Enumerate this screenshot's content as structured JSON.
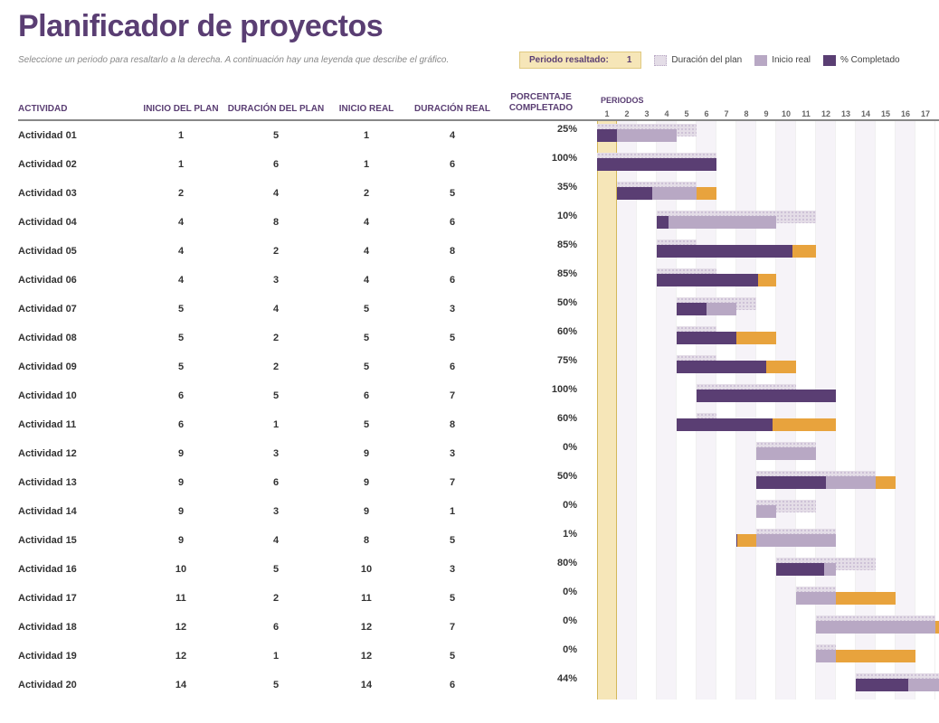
{
  "title": "Planificador de proyectos",
  "hint": "Seleccione un periodo para resaltarlo a la derecha. A continuación hay una leyenda que describe el gráfico.",
  "highlight": {
    "label": "Periodo resaltado:",
    "value": "1"
  },
  "legend": {
    "plan": "Duración del plan",
    "real": "Inicio real",
    "comp": "% Completado"
  },
  "columns": {
    "activity": "ACTIVIDAD",
    "plan_start": "INICIO DEL PLAN",
    "plan_dur": "DURACIÓN DEL PLAN",
    "actual_start": "INICIO REAL",
    "actual_dur": "DURACIÓN REAL",
    "pct": "PORCENTAJE COMPLETADO",
    "periods": "PERIODOS"
  },
  "periods": [
    "1",
    "2",
    "3",
    "4",
    "5",
    "6",
    "7",
    "8",
    "9",
    "10",
    "11",
    "12",
    "13",
    "14",
    "15",
    "16",
    "17"
  ],
  "highlighted_period": 1,
  "rows": [
    {
      "activity": "Actividad 01",
      "plan_start": 1,
      "plan_dur": 5,
      "actual_start": 1,
      "actual_dur": 4,
      "pct": "25%",
      "pct_num": 25
    },
    {
      "activity": "Actividad 02",
      "plan_start": 1,
      "plan_dur": 6,
      "actual_start": 1,
      "actual_dur": 6,
      "pct": "100%",
      "pct_num": 100
    },
    {
      "activity": "Actividad 03",
      "plan_start": 2,
      "plan_dur": 4,
      "actual_start": 2,
      "actual_dur": 5,
      "pct": "35%",
      "pct_num": 35
    },
    {
      "activity": "Actividad 04",
      "plan_start": 4,
      "plan_dur": 8,
      "actual_start": 4,
      "actual_dur": 6,
      "pct": "10%",
      "pct_num": 10
    },
    {
      "activity": "Actividad 05",
      "plan_start": 4,
      "plan_dur": 2,
      "actual_start": 4,
      "actual_dur": 8,
      "pct": "85%",
      "pct_num": 85
    },
    {
      "activity": "Actividad 06",
      "plan_start": 4,
      "plan_dur": 3,
      "actual_start": 4,
      "actual_dur": 6,
      "pct": "85%",
      "pct_num": 85
    },
    {
      "activity": "Actividad 07",
      "plan_start": 5,
      "plan_dur": 4,
      "actual_start": 5,
      "actual_dur": 3,
      "pct": "50%",
      "pct_num": 50
    },
    {
      "activity": "Actividad 08",
      "plan_start": 5,
      "plan_dur": 2,
      "actual_start": 5,
      "actual_dur": 5,
      "pct": "60%",
      "pct_num": 60
    },
    {
      "activity": "Actividad 09",
      "plan_start": 5,
      "plan_dur": 2,
      "actual_start": 5,
      "actual_dur": 6,
      "pct": "75%",
      "pct_num": 75
    },
    {
      "activity": "Actividad 10",
      "plan_start": 6,
      "plan_dur": 5,
      "actual_start": 6,
      "actual_dur": 7,
      "pct": "100%",
      "pct_num": 100
    },
    {
      "activity": "Actividad 11",
      "plan_start": 6,
      "plan_dur": 1,
      "actual_start": 5,
      "actual_dur": 8,
      "pct": "60%",
      "pct_num": 60
    },
    {
      "activity": "Actividad 12",
      "plan_start": 9,
      "plan_dur": 3,
      "actual_start": 9,
      "actual_dur": 3,
      "pct": "0%",
      "pct_num": 0
    },
    {
      "activity": "Actividad 13",
      "plan_start": 9,
      "plan_dur": 6,
      "actual_start": 9,
      "actual_dur": 7,
      "pct": "50%",
      "pct_num": 50
    },
    {
      "activity": "Actividad 14",
      "plan_start": 9,
      "plan_dur": 3,
      "actual_start": 9,
      "actual_dur": 1,
      "pct": "0%",
      "pct_num": 0
    },
    {
      "activity": "Actividad 15",
      "plan_start": 9,
      "plan_dur": 4,
      "actual_start": 8,
      "actual_dur": 5,
      "pct": "1%",
      "pct_num": 1
    },
    {
      "activity": "Actividad 16",
      "plan_start": 10,
      "plan_dur": 5,
      "actual_start": 10,
      "actual_dur": 3,
      "pct": "80%",
      "pct_num": 80
    },
    {
      "activity": "Actividad 17",
      "plan_start": 11,
      "plan_dur": 2,
      "actual_start": 11,
      "actual_dur": 5,
      "pct": "0%",
      "pct_num": 0
    },
    {
      "activity": "Actividad 18",
      "plan_start": 12,
      "plan_dur": 6,
      "actual_start": 12,
      "actual_dur": 7,
      "pct": "0%",
      "pct_num": 0
    },
    {
      "activity": "Actividad 19",
      "plan_start": 12,
      "plan_dur": 1,
      "actual_start": 12,
      "actual_dur": 5,
      "pct": "0%",
      "pct_num": 0
    },
    {
      "activity": "Actividad 20",
      "plan_start": 14,
      "plan_dur": 5,
      "actual_start": 14,
      "actual_dur": 6,
      "pct": "44%",
      "pct_num": 44
    }
  ],
  "chart_data": {
    "type": "bar",
    "title": "Planificador de proyectos",
    "xlabel": "PERIODOS",
    "ylabel": "ACTIVIDAD",
    "x": [
      1,
      2,
      3,
      4,
      5,
      6,
      7,
      8,
      9,
      10,
      11,
      12,
      13,
      14,
      15,
      16,
      17
    ],
    "series": [
      {
        "name": "Duración del plan",
        "color": "#E4DDE7",
        "start": [
          1,
          1,
          2,
          4,
          4,
          4,
          5,
          5,
          5,
          6,
          6,
          9,
          9,
          9,
          9,
          10,
          11,
          12,
          12,
          14
        ],
        "duration": [
          5,
          6,
          4,
          8,
          2,
          3,
          4,
          2,
          2,
          5,
          1,
          3,
          6,
          3,
          4,
          5,
          2,
          6,
          1,
          5
        ]
      },
      {
        "name": "Inicio real",
        "color": "#B8A8C4",
        "start": [
          1,
          1,
          2,
          4,
          4,
          4,
          5,
          5,
          5,
          6,
          5,
          9,
          9,
          9,
          8,
          10,
          11,
          12,
          12,
          14
        ],
        "duration": [
          4,
          6,
          5,
          6,
          8,
          6,
          3,
          5,
          6,
          7,
          8,
          3,
          7,
          1,
          5,
          3,
          5,
          7,
          5,
          6
        ]
      },
      {
        "name": "% Completado",
        "color": "#5A3E73",
        "values": [
          25,
          100,
          35,
          10,
          85,
          85,
          50,
          60,
          75,
          100,
          60,
          0,
          50,
          0,
          1,
          80,
          0,
          0,
          0,
          44
        ]
      }
    ],
    "categories": [
      "Actividad 01",
      "Actividad 02",
      "Actividad 03",
      "Actividad 04",
      "Actividad 05",
      "Actividad 06",
      "Actividad 07",
      "Actividad 08",
      "Actividad 09",
      "Actividad 10",
      "Actividad 11",
      "Actividad 12",
      "Actividad 13",
      "Actividad 14",
      "Actividad 15",
      "Actividad 16",
      "Actividad 17",
      "Actividad 18",
      "Actividad 19",
      "Actividad 20"
    ],
    "xlim": [
      1,
      17
    ]
  }
}
